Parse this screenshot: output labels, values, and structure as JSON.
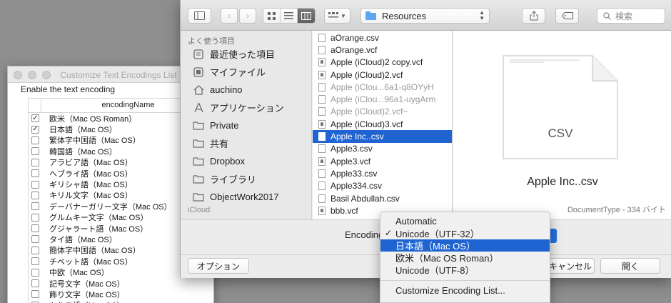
{
  "bg_window": {
    "title": "Customize Text Encodings List",
    "caption": "Enable the text encoding",
    "column_header": "encodingName",
    "rows": [
      {
        "label": "欧米（Mac OS Roman）",
        "checked": true
      },
      {
        "label": "日本語（Mac OS）",
        "checked": true
      },
      {
        "label": "繁体字中国語（Mac OS）",
        "checked": false
      },
      {
        "label": "韓国語（Mac OS）",
        "checked": false
      },
      {
        "label": "アラビア語（Mac OS）",
        "checked": false
      },
      {
        "label": "ヘブライ語（Mac OS）",
        "checked": false
      },
      {
        "label": "ギリシャ語（Mac OS）",
        "checked": false
      },
      {
        "label": "キリル文字（Mac OS）",
        "checked": false
      },
      {
        "label": "デーバナーガリー文字（Mac OS）",
        "checked": false
      },
      {
        "label": "グルムキー文字（Mac OS）",
        "checked": false
      },
      {
        "label": "グジャラート語（Mac OS）",
        "checked": false
      },
      {
        "label": "タイ語（Mac OS）",
        "checked": false
      },
      {
        "label": "簡体字中国語（Mac OS）",
        "checked": false
      },
      {
        "label": "チベット語（Mac OS）",
        "checked": false
      },
      {
        "label": "中欧（Mac OS）",
        "checked": false
      },
      {
        "label": "記号文字（Mac OS）",
        "checked": false
      },
      {
        "label": "飾り文字（Mac OS）",
        "checked": false
      },
      {
        "label": "トルコ語（Mac OS）",
        "checked": false
      }
    ]
  },
  "toolbar": {
    "location": "Resources",
    "search_placeholder": "検索"
  },
  "sidebar": {
    "section": "よく使う項目",
    "items": [
      {
        "label": "最近使った項目",
        "icon": "recents-icon"
      },
      {
        "label": "マイファイル",
        "icon": "all-files-icon"
      },
      {
        "label": "auchino",
        "icon": "home-icon"
      },
      {
        "label": "アプリケーション",
        "icon": "applications-icon"
      },
      {
        "label": "Private",
        "icon": "folder-icon"
      },
      {
        "label": "共有",
        "icon": "folder-icon"
      },
      {
        "label": "Dropbox",
        "icon": "folder-icon"
      },
      {
        "label": "ライブラリ",
        "icon": "folder-icon"
      },
      {
        "label": "ObjectWork2017",
        "icon": "folder-icon"
      }
    ],
    "cut_section": "iCloud"
  },
  "files": [
    {
      "name": "aOrange.csv",
      "kind": "doc",
      "dim": false,
      "selected": false
    },
    {
      "name": "aOrange.vcf",
      "kind": "doc",
      "dim": false,
      "selected": false
    },
    {
      "name": "Apple (iCloud)2 copy.vcf",
      "kind": "vcard",
      "dim": false,
      "selected": false
    },
    {
      "name": "Apple (iCloud)2.vcf",
      "kind": "vcard",
      "dim": false,
      "selected": false
    },
    {
      "name": "Apple (iClou...6a1-q8OYyH",
      "kind": "doc",
      "dim": true,
      "selected": false
    },
    {
      "name": "Apple (iClou...96a1-uygArm",
      "kind": "doc",
      "dim": true,
      "selected": false
    },
    {
      "name": "Apple (iCloud)2.vcf~",
      "kind": "doc",
      "dim": true,
      "selected": false
    },
    {
      "name": "Apple (iCloud)3.vcf",
      "kind": "vcard",
      "dim": false,
      "selected": false
    },
    {
      "name": "Apple Inc..csv",
      "kind": "doc",
      "dim": false,
      "selected": true
    },
    {
      "name": "Apple3.csv",
      "kind": "doc",
      "dim": false,
      "selected": false
    },
    {
      "name": "Apple3.vcf",
      "kind": "vcard",
      "dim": false,
      "selected": false
    },
    {
      "name": "Apple33.csv",
      "kind": "doc",
      "dim": false,
      "selected": false
    },
    {
      "name": "Apple334.csv",
      "kind": "doc",
      "dim": false,
      "selected": false
    },
    {
      "name": "Basil Abdullah.csv",
      "kind": "doc",
      "dim": false,
      "selected": false
    },
    {
      "name": "bbb.vcf",
      "kind": "vcard",
      "dim": false,
      "selected": false
    }
  ],
  "preview": {
    "doc_label": "CSV",
    "filename": "Apple Inc..csv",
    "meta": "DocumentType - 334 バイト"
  },
  "bottom": {
    "encoding_label": "Encoding",
    "options_button": "オプション",
    "cancel_button": "キャンセル",
    "open_button": "開く"
  },
  "menu": {
    "items": [
      {
        "label": "Automatic",
        "checked": false,
        "highlighted": false
      },
      {
        "label": "Unicode（UTF-32）",
        "checked": true,
        "highlighted": false
      },
      {
        "label": "日本語（Mac OS）",
        "checked": false,
        "highlighted": true
      },
      {
        "label": "欧米（Mac OS Roman）",
        "checked": false,
        "highlighted": false
      },
      {
        "label": "Unicode（UTF-8）",
        "checked": false,
        "highlighted": false
      }
    ],
    "customize": "Customize Encoding List...",
    "check_glyph": "✓"
  },
  "colors": {
    "selection": "#1f64d0",
    "folder": "#5aa7ee"
  }
}
